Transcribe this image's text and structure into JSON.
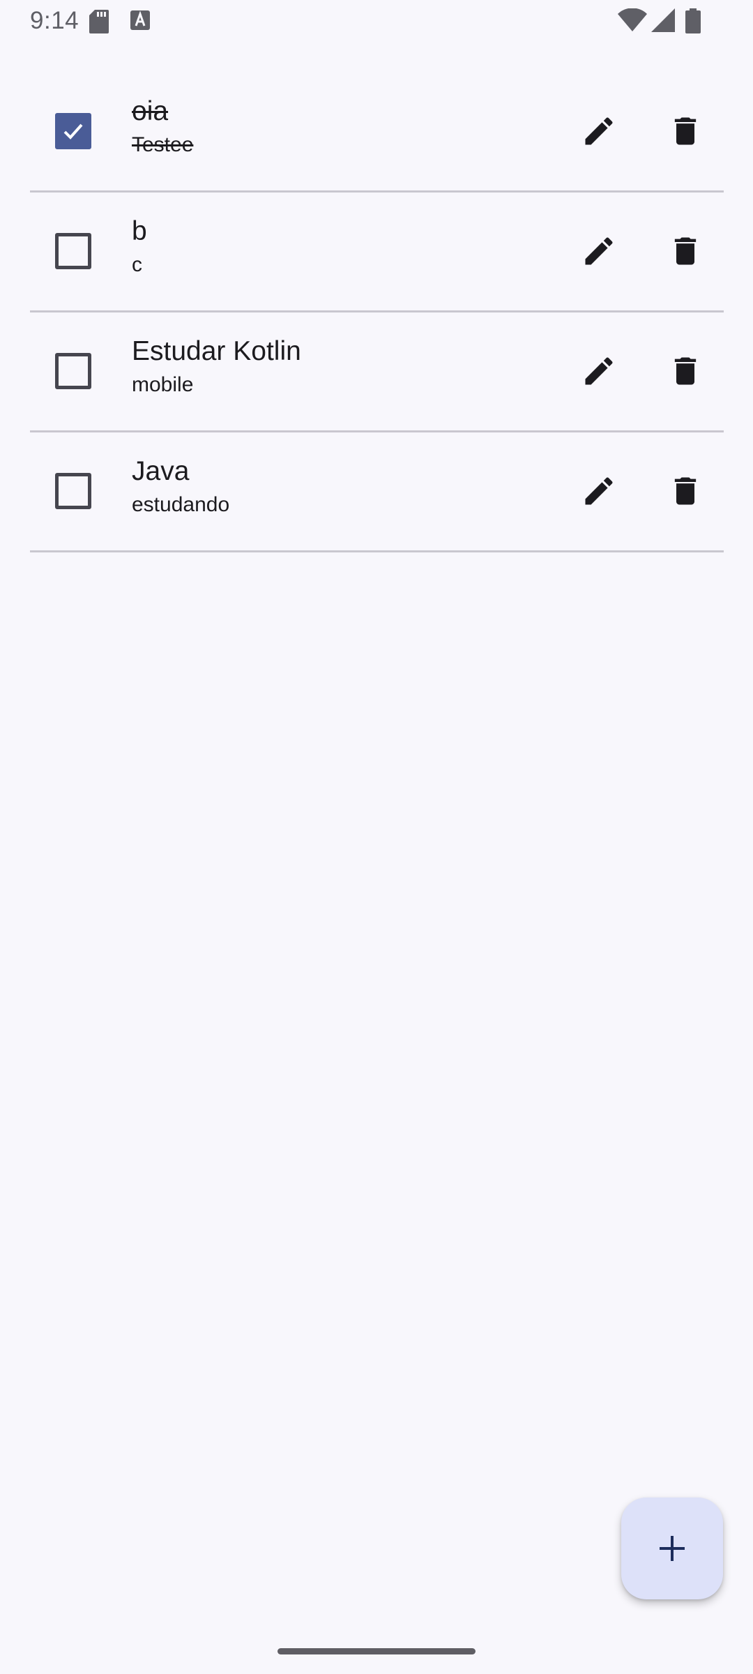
{
  "status_bar": {
    "time": "9:14",
    "left_icons": [
      "sd-card-icon",
      "keyboard-a-icon"
    ],
    "right_icons": [
      "wifi-icon",
      "signal-icon",
      "battery-icon"
    ]
  },
  "tasks": [
    {
      "title": "oia",
      "description": "Testee",
      "completed": true
    },
    {
      "title": "b",
      "description": "c",
      "completed": false
    },
    {
      "title": "Estudar Kotlin",
      "description": "mobile",
      "completed": false
    },
    {
      "title": "Java",
      "description": "estudando",
      "completed": false
    }
  ],
  "row_actions": {
    "edit_icon": "pencil-icon",
    "delete_icon": "trash-icon"
  },
  "fab": {
    "icon": "plus-icon"
  },
  "colors": {
    "background": "#f8f7fc",
    "checkbox_checked": "#4a5c97",
    "fab_background": "#dde1f9",
    "divider": "#c9c7cf",
    "icon": "#1c1b1f"
  }
}
